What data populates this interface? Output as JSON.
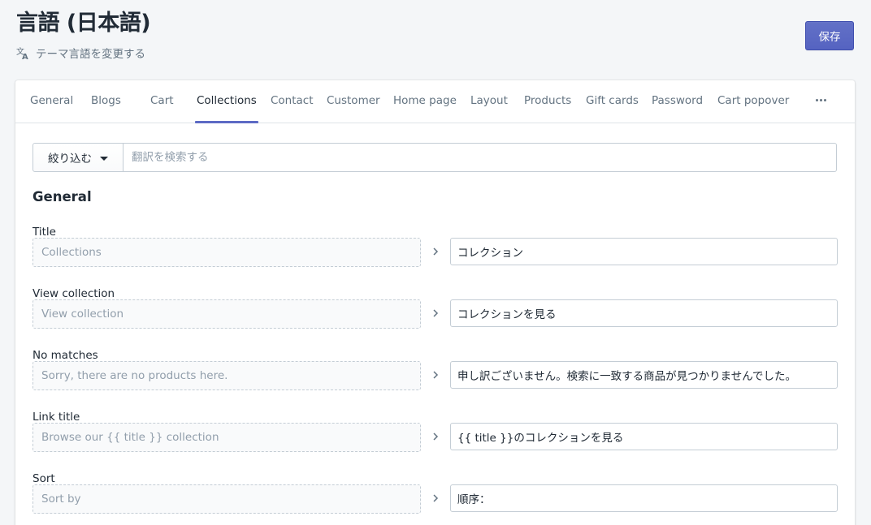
{
  "header": {
    "title": "言語 (日本語)",
    "subtitle": "テーマ言語を変更する",
    "save_label": "保存"
  },
  "tabs": [
    {
      "label": "General"
    },
    {
      "label": "Blogs"
    },
    {
      "label": "Cart"
    },
    {
      "label": "Collections",
      "active": true
    },
    {
      "label": "Contact"
    },
    {
      "label": "Customer"
    },
    {
      "label": "Home page"
    },
    {
      "label": "Layout"
    },
    {
      "label": "Products"
    },
    {
      "label": "Gift cards"
    },
    {
      "label": "Password"
    },
    {
      "label": "Cart popover"
    }
  ],
  "filter": {
    "button_label": "絞り込む",
    "search_placeholder": "翻訳を検索する"
  },
  "section": {
    "heading": "General",
    "fields": [
      {
        "label": "Title",
        "source": "Collections",
        "value": "コレクション"
      },
      {
        "label": "View collection",
        "source": "View collection",
        "value": "コレクションを見る"
      },
      {
        "label": "No matches",
        "source": "Sorry, there are no products here.",
        "value": "申し訳ございません。検索に一致する商品が見つかりませんでした。"
      },
      {
        "label": "Link title",
        "source": "Browse our {{ title }} collection",
        "value": "{{ title }}のコレクションを見る"
      },
      {
        "label": "Sort",
        "source": "Sort by",
        "value": "順序："
      }
    ]
  },
  "colors": {
    "accent": "#5c6ac4",
    "page_bg": "#f4f6f8"
  }
}
